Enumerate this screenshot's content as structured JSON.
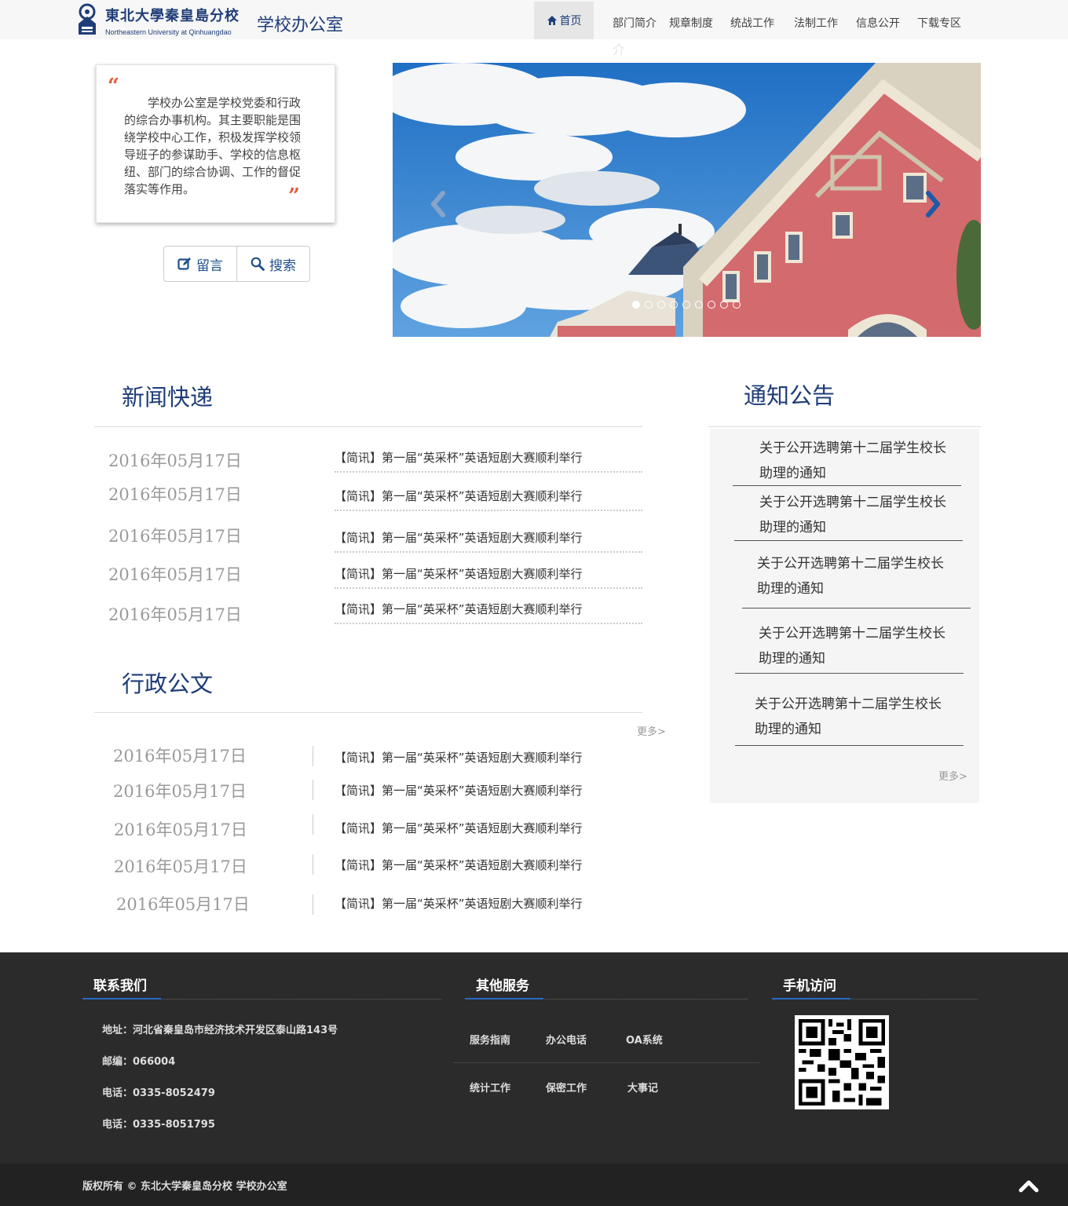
{
  "header": {
    "logo_cn": "東北大學秦皇島分校",
    "logo_en": "Northeastern University at Qinhuangdao",
    "site_title": "学校办公室",
    "nav": {
      "home": "首页",
      "items": [
        "部门简介",
        "规章制度",
        "统战工作",
        "法制工作",
        "信息公开",
        "下载专区"
      ],
      "ghost": "介"
    }
  },
  "intro": {
    "text": "学校办公室是学校党委和行政的综合办事机构。其主要职能是围绕学校中心工作，积极发挥学校领导班子的参谋助手、学校的信息枢纽、部门的综合协调、工作的督促落实等作用。",
    "quote_open": "“",
    "quote_close": "”",
    "btn_message": "留言",
    "btn_search": "搜索"
  },
  "carousel": {
    "slide_count": 9,
    "active_index": 0
  },
  "news": {
    "title": "新闻快递",
    "items": [
      {
        "date": "2016年05月17日",
        "text": "【简讯】第一届“英采杯”英语短剧大赛顺利举行"
      },
      {
        "date": "2016年05月17日",
        "text": "【简讯】第一届“英采杯”英语短剧大赛顺利举行"
      },
      {
        "date": "2016年05月17日",
        "text": "【简讯】第一届“英采杯”英语短剧大赛顺利举行"
      },
      {
        "date": "2016年05月17日",
        "text": "【简讯】第一届“英采杯”英语短剧大赛顺利举行"
      },
      {
        "date": "2016年05月17日",
        "text": "【简讯】第一届“英采杯”英语短剧大赛顺利举行"
      }
    ]
  },
  "docs": {
    "title": "行政公文",
    "more": "更多>",
    "items": [
      {
        "date": "2016年05月17日",
        "text": "【简讯】第一届“英采杯”英语短剧大赛顺利举行"
      },
      {
        "date": "2016年05月17日",
        "text": "【简讯】第一届“英采杯”英语短剧大赛顺利举行"
      },
      {
        "date": "2016年05月17日",
        "text": "【简讯】第一届“英采杯”英语短剧大赛顺利举行"
      },
      {
        "date": "2016年05月17日",
        "text": "【简讯】第一届“英采杯”英语短剧大赛顺利举行"
      },
      {
        "date": "2016年05月17日",
        "text": "【简讯】第一届“英采杯”英语短剧大赛顺利举行"
      }
    ]
  },
  "notices": {
    "title": "通知公告",
    "more": "更多>",
    "items": [
      {
        "text": "关于公开选聘第十二届学生校长助理的通知"
      },
      {
        "text": "关于公开选聘第十二届学生校长助理的通知"
      },
      {
        "text": "关于公开选聘第十二届学生校长助理的通知"
      },
      {
        "text": "关于公开选聘第十二届学生校长助理的通知"
      },
      {
        "text": "关于公开选聘第十二届学生校长助理的通知"
      }
    ]
  },
  "footer": {
    "contact_title": "联系我们",
    "address": "地址：河北省秦皇岛市经济技术开发区泰山路143号",
    "postcode": "邮编：066004",
    "phone1": "电话：0335-8052479",
    "phone2": "电话：0335-8051795",
    "services_title": "其他服务",
    "services": [
      "服务指南",
      "办公电话",
      "OA系统",
      "统计工作",
      "保密工作",
      "大事记"
    ],
    "mobile_title": "手机访问",
    "copyright": "版权所有 © 东北大学秦皇岛分校 学校办公室",
    "accent_color": "#2a6ac2"
  }
}
